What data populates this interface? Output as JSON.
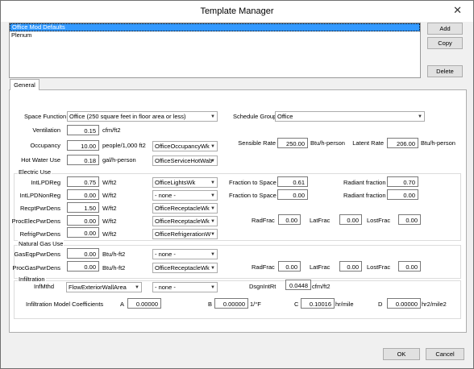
{
  "window": {
    "title": "Template Manager",
    "close_glyph": "✕"
  },
  "templates": {
    "items": [
      "Office Mod Defaults",
      "Plenum"
    ]
  },
  "buttons": {
    "add": "Add",
    "copy": "Copy",
    "delete": "Delete",
    "ok": "OK",
    "cancel": "Cancel"
  },
  "tab": {
    "general": "General"
  },
  "space": {
    "function_label": "Space Function",
    "function_value": "Office (250 square feet in floor area or less)",
    "schedule_group_label": "Schedule Group",
    "schedule_group_value": "Office",
    "ventilation_label": "Ventilation",
    "ventilation_value": "0.15",
    "ventilation_unit": "cfm/ft2",
    "occupancy_label": "Occupancy",
    "occupancy_value": "10.00",
    "occupancy_unit": "people/1,000 ft2",
    "occupancy_schedule": "OfficeOccupancyWk",
    "hotwater_label": "Hot Water Use",
    "hotwater_value": "0.18",
    "hotwater_unit": "gal/h-person",
    "hotwater_schedule": "OfficeServiceHotWab",
    "sensible_label": "Sensible Rate",
    "sensible_value": "250.00",
    "sensible_unit": "Btu/h-person",
    "latent_label": "Latent Rate",
    "latent_value": "206.00",
    "latent_unit": "Btu/h-person"
  },
  "electric": {
    "group_label": "Electric Use",
    "rows": [
      {
        "label": "IntLPDReg",
        "value": "0.75",
        "unit": "W/ft2",
        "schedule": "OfficeLightsWk"
      },
      {
        "label": "IntLPDNonReg",
        "value": "0.00",
        "unit": "W/ft2",
        "schedule": "- none -"
      },
      {
        "label": "RecptPwrDens",
        "value": "1.50",
        "unit": "W/ft2",
        "schedule": "OfficeReceptacleWk"
      },
      {
        "label": "ProcElecPwrDens",
        "value": "0.00",
        "unit": "W/ft2",
        "schedule": "OfficeReceptacleWk"
      },
      {
        "label": "RefrigPwrDens",
        "value": "0.00",
        "unit": "W/ft2",
        "schedule": "OfficeRefrigerationW"
      }
    ],
    "fraction_to_space_label": "Fraction to Space",
    "fraction_to_space_1": "0.61",
    "fraction_to_space_2": "0.00",
    "radiant_fraction_label": "Radiant fraction",
    "radiant_fraction_1": "0.70",
    "radiant_fraction_2": "0.00",
    "radfrac_label": "RadFrac",
    "radfrac_value": "0.00",
    "latfrac_label": "LatFrac",
    "latfrac_value": "0.00",
    "lostfrac_label": "LostFrac",
    "lostfrac_value": "0.00"
  },
  "gas": {
    "group_label": "Natural Gas Use",
    "rows": [
      {
        "label": "GasEqpPwrDens",
        "value": "0.00",
        "unit": "Btu/h-ft2",
        "schedule": "- none -"
      },
      {
        "label": "ProcGasPwrDens",
        "value": "0.00",
        "unit": "Btu/h-ft2",
        "schedule": "OfficeReceptacleWk"
      }
    ],
    "radfrac_label": "RadFrac",
    "radfrac_value": "0.00",
    "latfrac_label": "LatFrac",
    "latfrac_value": "0.00",
    "lostfrac_label": "LostFrac",
    "lostfrac_value": "0.00"
  },
  "infiltration": {
    "group_label": "Infiltration",
    "method_label": "InfMthd",
    "method_value": "FlowExteriorWallArea",
    "schedule": "- none -",
    "dsgn_label": "DsgnIntRt",
    "dsgn_value": "0.0448",
    "dsgn_unit": "cfm/ft2",
    "coeff_label": "Infiltration Model Coefficients",
    "a_label": "A",
    "a_value": "0.00000",
    "b_label": "B",
    "b_value": "0.00000",
    "b_unit": "1/°F",
    "c_label": "C",
    "c_value": "0.10016",
    "c_unit": "hr/mile",
    "d_label": "D",
    "d_value": "0.00000",
    "d_unit": "hr2/mile2"
  },
  "icons": {
    "dropdown": "▼"
  },
  "colors": {
    "selection": "#3399ff"
  }
}
